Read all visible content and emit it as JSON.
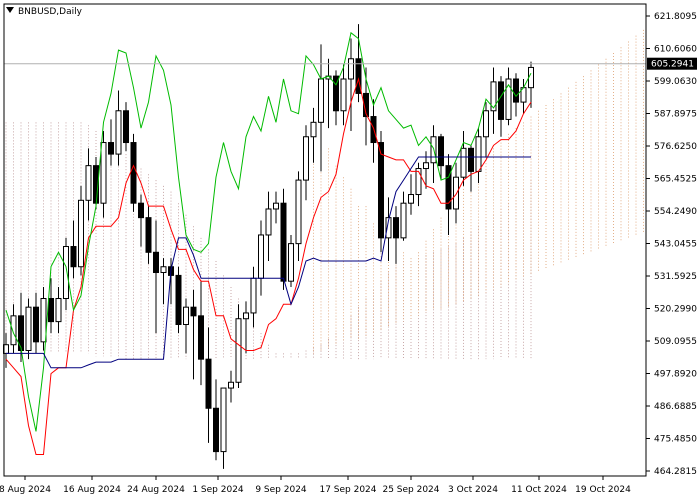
{
  "chart_data": {
    "type": "candlestick",
    "symbol_label": "BNBUSD,Daily",
    "current_price": "605.2941",
    "y_ticks": [
      "621.8095",
      "610.6060",
      "599.0630",
      "587.8975",
      "576.6250",
      "565.4525",
      "554.2490",
      "543.0455",
      "531.5925",
      "520.2990",
      "509.0955",
      "497.8920",
      "486.6885",
      "475.4850",
      "464.2815"
    ],
    "x_ticks": [
      "8 Aug 2024",
      "16 Aug 2024",
      "24 Aug 2024",
      "1 Sep 2024",
      "9 Sep 2024",
      "17 Sep 2024",
      "25 Sep 2024",
      "3 Oct 2024",
      "11 Oct 2024",
      "19 Oct 2024"
    ],
    "ylim": [
      464.2815,
      621.8095
    ],
    "ohlc": [
      [
        505,
        512,
        500,
        508
      ],
      [
        508,
        522,
        505,
        518
      ],
      [
        518,
        526,
        502,
        506
      ],
      [
        506,
        524,
        503,
        521
      ],
      [
        521,
        526,
        505,
        509
      ],
      [
        509,
        528,
        506,
        524
      ],
      [
        524,
        531,
        512,
        516
      ],
      [
        516,
        528,
        512,
        524
      ],
      [
        524,
        545,
        520,
        542
      ],
      [
        542,
        551,
        531,
        535
      ],
      [
        535,
        563,
        532,
        558
      ],
      [
        558,
        576,
        551,
        570
      ],
      [
        570,
        573,
        555,
        557
      ],
      [
        557,
        582,
        552,
        578
      ],
      [
        578,
        586,
        570,
        574
      ],
      [
        574,
        596,
        570,
        589
      ],
      [
        589,
        592,
        575,
        578
      ],
      [
        578,
        581,
        554,
        557
      ],
      [
        557,
        560,
        542,
        552
      ],
      [
        552,
        556,
        536,
        540
      ],
      [
        540,
        551,
        512,
        533
      ],
      [
        533,
        538,
        522,
        535
      ],
      [
        535,
        538,
        522,
        532
      ],
      [
        532,
        535,
        512,
        515
      ],
      [
        515,
        524,
        505,
        521
      ],
      [
        521,
        527,
        496,
        518
      ],
      [
        518,
        530,
        494,
        503
      ],
      [
        503,
        514,
        474,
        486
      ],
      [
        486,
        496,
        468,
        471
      ],
      [
        471,
        493,
        465,
        493
      ],
      [
        493,
        499,
        488,
        495
      ],
      [
        495,
        522,
        493,
        517
      ],
      [
        517,
        523,
        505,
        519
      ],
      [
        519,
        535,
        514,
        531
      ],
      [
        531,
        551,
        525,
        546
      ],
      [
        546,
        561,
        537,
        555
      ],
      [
        555,
        561,
        550,
        557
      ],
      [
        557,
        562,
        527,
        530
      ],
      [
        530,
        546,
        528,
        543
      ],
      [
        543,
        568,
        537,
        565
      ],
      [
        565,
        584,
        558,
        580
      ],
      [
        580,
        590,
        571,
        585
      ],
      [
        585,
        612,
        568,
        600
      ],
      [
        600,
        607,
        583,
        601
      ],
      [
        601,
        603,
        584,
        589
      ],
      [
        589,
        605,
        584,
        600
      ],
      [
        600,
        614,
        582,
        607
      ],
      [
        607,
        619,
        592,
        595
      ],
      [
        595,
        604,
        577,
        587
      ],
      [
        587,
        593,
        571,
        578
      ],
      [
        578,
        582,
        540,
        545
      ],
      [
        545,
        559,
        537,
        552
      ],
      [
        552,
        556,
        536,
        545
      ],
      [
        545,
        561,
        544,
        557
      ],
      [
        557,
        567,
        553,
        560
      ],
      [
        560,
        571,
        556,
        569
      ],
      [
        569,
        575,
        562,
        571
      ],
      [
        571,
        584,
        564,
        580
      ],
      [
        580,
        581,
        565,
        570
      ],
      [
        570,
        574,
        546,
        555
      ],
      [
        555,
        571,
        550,
        566
      ],
      [
        566,
        582,
        563,
        576
      ],
      [
        576,
        577,
        561,
        568
      ],
      [
        568,
        583,
        564,
        580
      ],
      [
        580,
        592,
        573,
        589
      ],
      [
        589,
        604,
        581,
        599
      ],
      [
        599,
        601,
        580,
        586
      ],
      [
        586,
        604,
        584,
        600
      ],
      [
        600,
        602,
        587,
        592
      ],
      [
        592,
        600,
        588,
        597
      ],
      [
        597,
        606,
        590,
        604
      ]
    ],
    "series": [
      {
        "color": "#ff0000",
        "values": [
          503,
          500,
          497,
          480,
          470,
          470,
          498,
          500,
          500,
          520,
          528,
          545,
          549,
          549,
          549,
          552,
          564,
          570,
          564,
          556,
          556,
          556,
          548,
          541,
          541,
          534,
          530,
          530,
          518,
          518,
          510,
          508,
          506,
          506,
          507,
          515,
          517,
          522,
          522,
          531,
          543,
          552,
          559,
          561,
          567,
          581,
          592,
          600,
          588,
          583,
          574,
          573,
          572,
          572,
          568,
          568,
          563,
          562,
          557,
          557,
          560,
          565,
          567,
          568,
          572,
          577,
          579,
          579,
          582,
          588,
          592
        ]
      },
      {
        "color": "#00bb00",
        "values": [
          520,
          512,
          507,
          490,
          478,
          500,
          535,
          540,
          535,
          520,
          525,
          542,
          556,
          585,
          595,
          610,
          609,
          597,
          583,
          592,
          608,
          603,
          591,
          566,
          546,
          541,
          540,
          543,
          566,
          578,
          568,
          562,
          580,
          587,
          582,
          594,
          585,
          600,
          589,
          588,
          608,
          605,
          600,
          601,
          598,
          604,
          616,
          614,
          600,
          591,
          597,
          589,
          586,
          583,
          584,
          577,
          580,
          576,
          565,
          566,
          572,
          578,
          577,
          583,
          593,
          590,
          594,
          598,
          594,
          597,
          602
        ]
      },
      {
        "color": "#00007f",
        "values": [
          505,
          505,
          505,
          505,
          505,
          505,
          500,
          500,
          500,
          500,
          500,
          501,
          502,
          502,
          502,
          503,
          503,
          503,
          503,
          503,
          503,
          503,
          534,
          545,
          545,
          539,
          531,
          531,
          531,
          531,
          531,
          531,
          531,
          531,
          531,
          531,
          531,
          531,
          522,
          528,
          537,
          538,
          537,
          537,
          537,
          537,
          537,
          537,
          537,
          538,
          537,
          551,
          561,
          565,
          569,
          573,
          573,
          573,
          573,
          573,
          573,
          573,
          573,
          573,
          573,
          573,
          573,
          573,
          573,
          573,
          573
        ]
      }
    ],
    "cloud_top": [
      585,
      585,
      585,
      585,
      585,
      585,
      585,
      585,
      585,
      585,
      585,
      584,
      582,
      580,
      578,
      576,
      574,
      571,
      569,
      567,
      565,
      563,
      561,
      557,
      553,
      549,
      545,
      541,
      537,
      532,
      528,
      524,
      520,
      516,
      512,
      508,
      505,
      505,
      505,
      505,
      506,
      507,
      508,
      510,
      512,
      515,
      518,
      521,
      524,
      527,
      530,
      533,
      535,
      537,
      537,
      538,
      539,
      540,
      541,
      542,
      543,
      545,
      547,
      549,
      551,
      553,
      555,
      557,
      559,
      562,
      565
    ],
    "cloud_bottom": [
      505,
      505,
      505,
      505,
      505,
      505,
      505,
      505,
      505,
      505,
      505,
      505,
      504,
      504,
      504,
      504,
      503,
      503,
      503,
      503,
      503,
      503,
      503,
      503,
      503,
      503,
      503,
      503,
      503,
      503,
      503,
      503,
      503,
      503,
      503,
      503,
      503,
      503,
      503,
      503,
      503,
      503,
      503,
      503,
      503,
      503,
      503,
      503,
      503,
      503,
      503,
      503,
      503,
      503,
      503,
      503,
      503,
      503,
      503,
      503,
      503,
      503,
      503,
      503,
      503,
      503,
      503,
      503,
      503,
      503,
      503
    ],
    "forward_cloud_top": [
      580,
      576,
      576,
      570,
      566,
      562,
      556,
      556,
      550,
      548,
      546,
      543,
      540,
      538,
      540,
      544,
      548,
      552,
      556,
      560,
      563,
      566,
      570,
      574,
      577,
      579,
      581,
      583,
      585,
      587,
      589,
      591,
      593,
      595,
      597,
      599,
      601,
      603,
      605,
      607,
      609,
      611,
      613,
      615,
      617,
      619,
      620,
      621,
      621,
      622
    ],
    "forward_cloud_bottom": [
      505,
      506,
      507,
      508,
      509,
      510,
      510,
      511,
      512,
      513,
      514,
      515,
      516,
      517,
      518,
      519,
      520,
      520,
      521,
      522,
      523,
      524,
      525,
      526,
      527,
      528,
      529,
      530,
      531,
      532,
      533,
      534,
      535,
      536,
      537,
      538,
      539,
      540,
      541,
      542,
      543,
      544,
      545,
      546,
      547,
      548,
      549,
      550,
      551,
      552
    ]
  }
}
